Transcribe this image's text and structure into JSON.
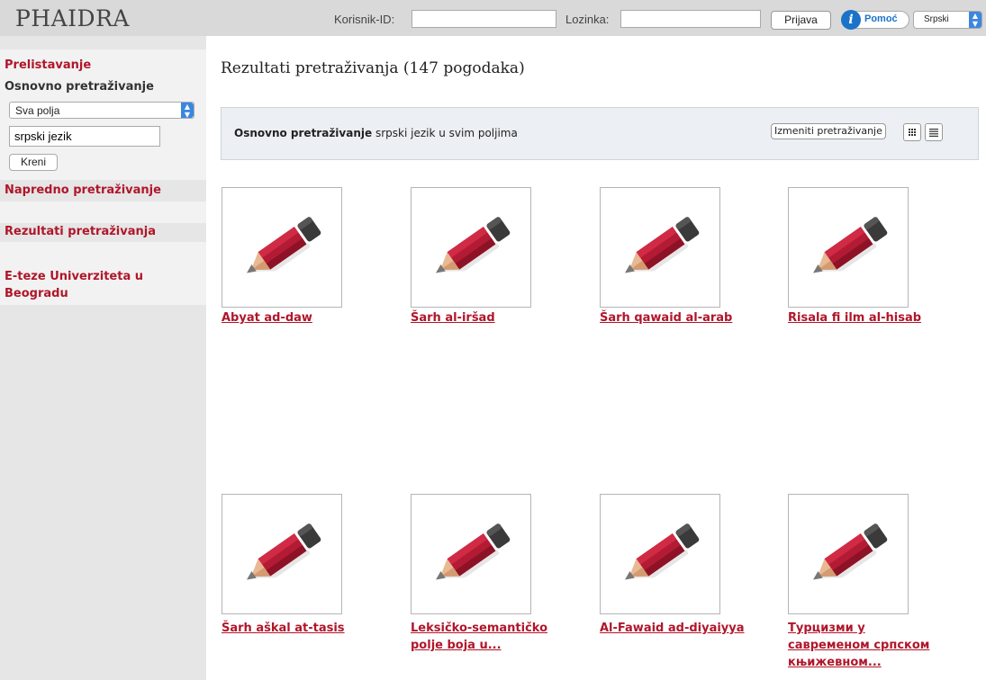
{
  "app": {
    "title": "PHAIDRA"
  },
  "login": {
    "user_label": "Korisnik-ID:",
    "user_value": "",
    "password_label": "Lozinka:",
    "password_value": "",
    "submit_label": "Prijava"
  },
  "help": {
    "label": "Pomoć",
    "icon": "info-icon"
  },
  "language": {
    "selected": "Srpski"
  },
  "sidebar": {
    "browse": "Prelistavanje",
    "basic_search_heading": "Osnovno pretraživanje",
    "field_select": "Sva polja",
    "query_value": "srpski jezik",
    "go_button": "Kreni",
    "advanced_search": "Napredno pretraživanje",
    "search_results": "Rezultati pretraživanja",
    "collection_line1": "E-teze Univerziteta u",
    "collection_line2": "Beogradu"
  },
  "main": {
    "heading": "Rezultati pretraživanja (147 pogodaka)",
    "query": {
      "label": "Osnovno pretraživanje",
      "description": "srpski jezik u svim poljima"
    },
    "modify_button": "Izmeniti pretraživanje",
    "view_grid_icon": "grid-view-icon",
    "view_list_icon": "list-view-icon",
    "results": [
      {
        "lines": [
          "Abyat ad-daw"
        ]
      },
      {
        "lines": [
          "Šarh al-iršad"
        ]
      },
      {
        "lines": [
          "Šarh qawaid al-arab"
        ]
      },
      {
        "lines": [
          "Risala fi ilm al-hisab"
        ]
      },
      {
        "lines": [
          "Šarh aškal at-tasis"
        ]
      },
      {
        "lines": [
          "Leksičko-semantičko",
          "polje boja u..."
        ]
      },
      {
        "lines": [
          "Al-Fawaid ad-diyaiyya"
        ]
      },
      {
        "lines": [
          "Турцизми у",
          "савременом српском",
          "књижевном..."
        ]
      }
    ]
  },
  "colors": {
    "accent": "#b0162a",
    "topbar": "#d9d9d9",
    "sidebar": "#e6e6e6",
    "pencil_red": "#b31b34",
    "pencil_dark": "#3a3a3a"
  }
}
